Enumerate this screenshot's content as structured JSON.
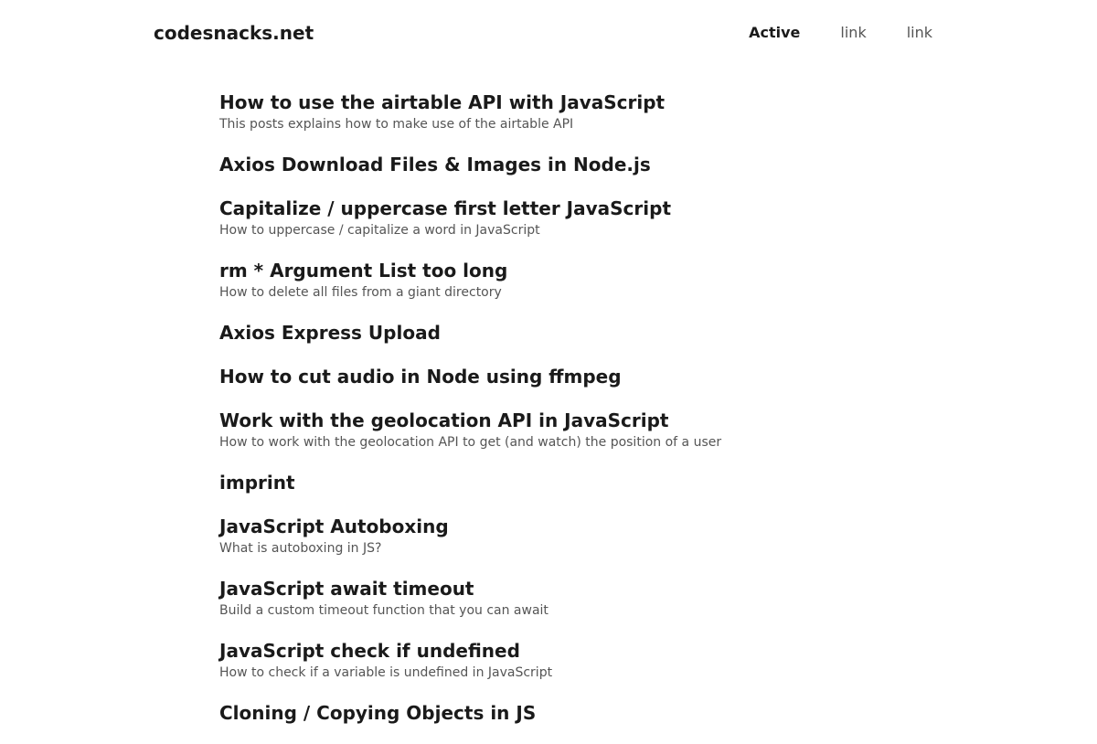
{
  "header": {
    "brand": "codesnacks.net",
    "nav": [
      {
        "label": "Active",
        "active": true
      },
      {
        "label": "link",
        "active": false
      },
      {
        "label": "link",
        "active": false
      }
    ]
  },
  "posts": [
    {
      "title": "How to use the airtable API with JavaScript",
      "description": "This posts explains how to make use of the airtable API"
    },
    {
      "title": "Axios Download Files & Images in Node.js",
      "description": ""
    },
    {
      "title": "Capitalize / uppercase first letter JavaScript",
      "description": "How to uppercase / capitalize a word in JavaScript"
    },
    {
      "title": "rm * Argument List too long",
      "description": "How to delete all files from a giant directory"
    },
    {
      "title": "Axios Express Upload",
      "description": ""
    },
    {
      "title": "How to cut audio in Node using ffmpeg",
      "description": ""
    },
    {
      "title": "Work with the geolocation API in JavaScript",
      "description": "How to work with the geolocation API to get (and watch) the position of a user"
    },
    {
      "title": "imprint",
      "description": ""
    },
    {
      "title": "JavaScript Autoboxing",
      "description": "What is autoboxing in JS?"
    },
    {
      "title": "JavaScript await timeout",
      "description": "Build a custom timeout function that you can await"
    },
    {
      "title": "JavaScript check if undefined",
      "description": "How to check if a variable is undefined in JavaScript"
    },
    {
      "title": "Cloning / Copying Objects in JS",
      "description": ""
    }
  ]
}
